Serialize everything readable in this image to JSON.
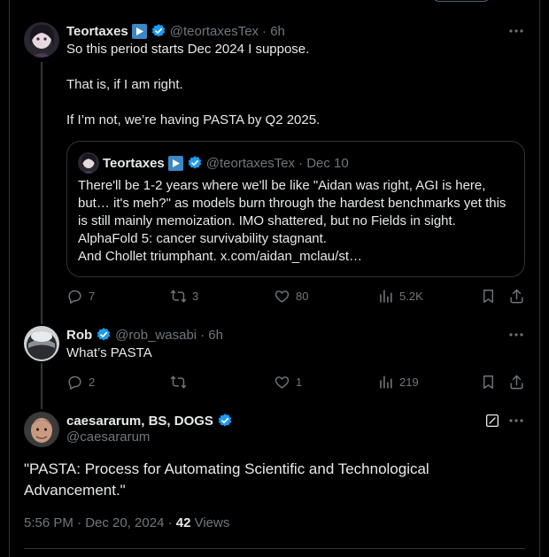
{
  "colors": {
    "background": "#000000",
    "text": "#e7e9ea",
    "muted": "#71767b",
    "border": "#2f3336",
    "verified": "#1d9bf0",
    "play_badge": "#3b88c3"
  },
  "post1": {
    "name": "Teortaxes",
    "handle": "@teortaxesTex",
    "time": "· 6h",
    "text": "So this period starts Dec 2024 I suppose.\n\nThat is, if I am right.\n\nIf I’m not, we’re having PASTA by Q2 2025.",
    "quote": {
      "name": "Teortaxes",
      "handle": "@teortaxesTex",
      "time": "· Dec 10",
      "text": "There'll be 1-2 years where we'll be like \"Aidan was right, AGI is here, but… it's meh?\" as models burn through the hardest benchmarks yet this is still mainly memoization. IMO shattered, but no Fields in sight.\nAlphaFold 5: cancer survivability stagnant.\nAnd Chollet triumphant. x.com/aidan_mclau/st…"
    },
    "actions": {
      "replies": "7",
      "reposts": "3",
      "likes": "80",
      "views": "5.2K"
    }
  },
  "post2": {
    "name": "Rob",
    "handle": "@rob_wasabi",
    "time": "· 6h",
    "text": "What’s PASTA",
    "actions": {
      "replies": "2",
      "reposts": "",
      "likes": "1",
      "views": "219"
    }
  },
  "main": {
    "name": "caesararum, BS, DOGS",
    "handle": "@caesararum",
    "text": "\"PASTA: Process for Automating Scientific and Technological Advancement.\"",
    "timestamp": "5:56 PM · Dec 20, 2024 · ",
    "views_count": "42",
    "views_label": " Views"
  },
  "icons": [
    "more-icon",
    "verified-icon",
    "play-badge-icon",
    "reply-icon",
    "repost-icon",
    "like-icon",
    "views-icon",
    "bookmark-icon",
    "share-icon",
    "edit-icon"
  ]
}
